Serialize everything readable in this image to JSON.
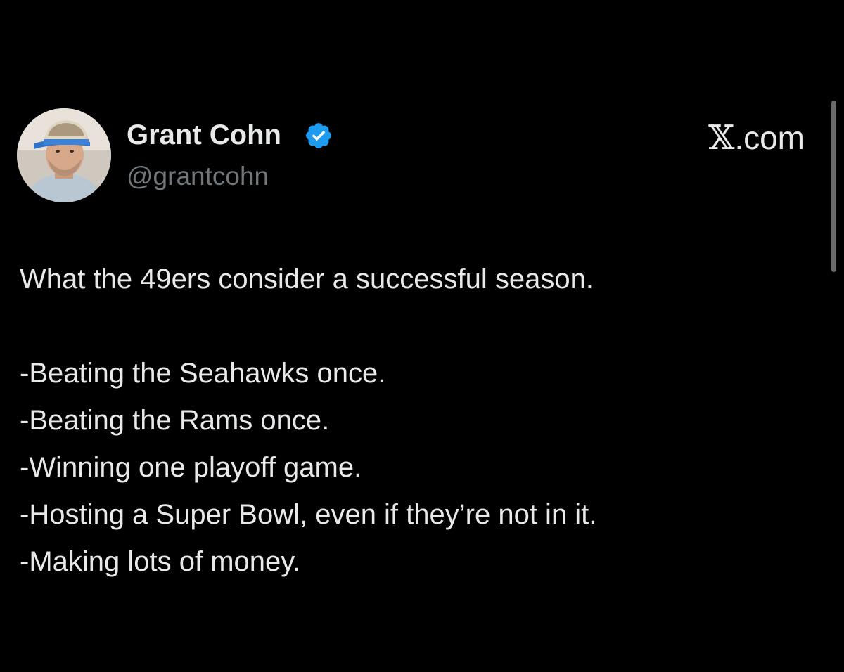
{
  "author": {
    "name": "Grant Cohn",
    "handle": "@grantcohn",
    "verified": true,
    "badge_color": "#1d9bf0",
    "avatar_icon": "profile-photo"
  },
  "source": {
    "label": ".com",
    "brand_glyph": "𝕏"
  },
  "tweet": {
    "intro": "What the 49ers consider a successful season.",
    "items": [
      "-Beating the Seahawks once.",
      "-Beating the Rams once.",
      "-Winning one playoff game.",
      "-Hosting a Super Bowl, even if they’re not in it.",
      "-Making lots of money."
    ]
  },
  "colors": {
    "background": "#000000",
    "text": "#e7e9ea",
    "secondary_text": "#71767b"
  }
}
